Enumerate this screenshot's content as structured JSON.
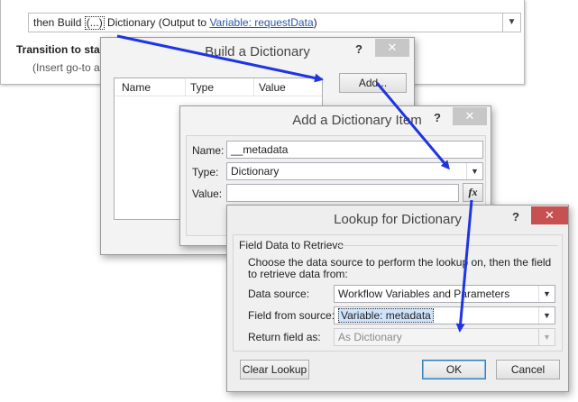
{
  "workflow": {
    "action_prefix": "then Build ",
    "action_ellipsis": "(...)",
    "action_middle": " Dictionary (Output to ",
    "action_link": "Variable: requestData",
    "action_suffix": ")",
    "transition_label": "Transition to stag",
    "transition_hint": "(Insert go-to ac"
  },
  "build_dialog": {
    "title": "Build a Dictionary",
    "help": "?",
    "close": "✕",
    "columns": [
      "Name",
      "Type",
      "Value"
    ],
    "add_button": "Add..."
  },
  "add_item_dialog": {
    "title": "Add a Dictionary Item",
    "help": "?",
    "close": "✕",
    "name_label": "Name:",
    "name_value": "__metadata",
    "type_label": "Type:",
    "type_value": "Dictionary",
    "value_label": "Value:",
    "value_value": "",
    "fx_label": "fx"
  },
  "lookup_dialog": {
    "title": "Lookup for Dictionary",
    "help": "?",
    "close": "✕",
    "group_title": "Field Data to Retrieve",
    "instructions": "Choose the data source to perform the lookup on, then the field to retrieve data from:",
    "data_source_label": "Data source:",
    "data_source_value": "Workflow Variables and Parameters",
    "field_label": "Field from source:",
    "field_value": "Variable: metadata",
    "return_label": "Return field as:",
    "return_value": "As Dictionary",
    "clear_button": "Clear Lookup",
    "ok_button": "OK",
    "cancel_button": "Cancel"
  },
  "colors": {
    "annotation_arrow": "#1f35e0",
    "link": "#2a58a8",
    "close_active": "#c75050"
  }
}
